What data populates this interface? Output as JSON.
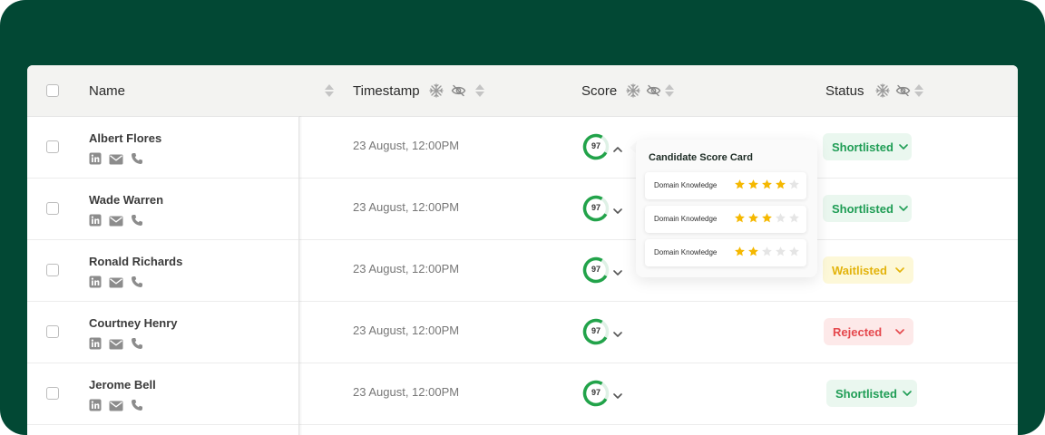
{
  "table": {
    "headers": {
      "name": "Name",
      "timestamp": "Timestamp",
      "score": "Score",
      "status": "Status"
    },
    "rows": [
      {
        "name": "Albert Flores",
        "timestamp": "23 August, 12:00PM",
        "score": "97",
        "score_fraction": 0.75,
        "status": "Shortlisted",
        "status_type": "shortlisted",
        "score_expanded": true
      },
      {
        "name": "Wade Warren",
        "timestamp": "23 August, 12:00PM",
        "score": "97",
        "score_fraction": 0.75,
        "status": "Shortlisted",
        "status_type": "shortlisted",
        "score_expanded": false
      },
      {
        "name": "Ronald Richards",
        "timestamp": "23 August, 12:00PM",
        "score": "97",
        "score_fraction": 0.75,
        "status": "Waitlisted",
        "status_type": "waitlisted",
        "score_expanded": false
      },
      {
        "name": "Courtney Henry",
        "timestamp": "23 August, 12:00PM",
        "score": "97",
        "score_fraction": 0.75,
        "status": "Rejected",
        "status_type": "rejected",
        "score_expanded": false
      },
      {
        "name": "Jerome Bell",
        "timestamp": "23 August, 12:00PM",
        "score": "97",
        "score_fraction": 0.75,
        "status": "Shortlisted",
        "status_type": "shortlisted",
        "score_expanded": false
      }
    ]
  },
  "score_card": {
    "title": "Candidate Score Card",
    "items": [
      {
        "label": "Domain Knowledge",
        "rating": 4,
        "max": 5
      },
      {
        "label": "Domain Knowledge",
        "rating": 3,
        "max": 5
      },
      {
        "label": "Domain Knowledge",
        "rating": 2,
        "max": 5
      }
    ]
  },
  "icons": {
    "contact": [
      "linkedin-icon",
      "email-icon",
      "phone-icon"
    ],
    "header": [
      "freeze-icon",
      "hide-icon",
      "sort-icon"
    ]
  },
  "colors": {
    "background": "#024834",
    "shortlisted": "#1f9d55",
    "waitlisted": "#e3b30b",
    "rejected": "#e5484d",
    "score_ring": "#22a34a",
    "star_filled": "#f5b800",
    "star_empty": "#e5e5e5"
  }
}
